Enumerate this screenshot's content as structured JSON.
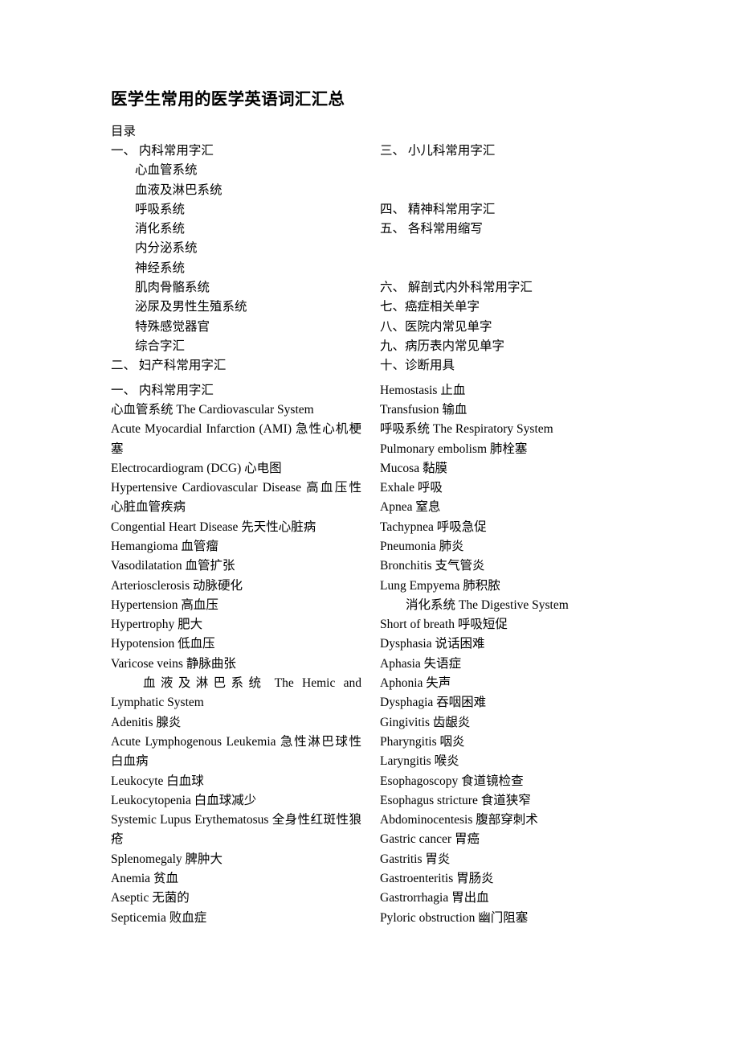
{
  "document": {
    "title": "医学生常用的医学英语词汇汇总",
    "toc_heading": "目录"
  },
  "toc": {
    "left": [
      {
        "text": "一、 内科常用字汇",
        "style": "num"
      },
      {
        "text": "心血管系统",
        "style": "indent"
      },
      {
        "text": "血液及淋巴系统",
        "style": "indent"
      },
      {
        "text": "呼吸系统",
        "style": "indent"
      },
      {
        "text": "消化系统",
        "style": "indent"
      },
      {
        "text": "内分泌系统",
        "style": "indent"
      },
      {
        "text": "神经系统",
        "style": "indent"
      },
      {
        "text": "肌肉骨骼系统",
        "style": "indent"
      },
      {
        "text": "泌尿及男性生殖系统",
        "style": "indent"
      },
      {
        "text": "特殊感觉器官",
        "style": "indent"
      },
      {
        "text": "综合字汇",
        "style": "indent"
      },
      {
        "text": "二、 妇产科常用字汇",
        "style": "num"
      }
    ],
    "right": [
      {
        "text": "三、 小儿科常用字汇",
        "style": "num"
      },
      {
        "text": "",
        "style": "blank"
      },
      {
        "text": "",
        "style": "blank"
      },
      {
        "text": "四、 精神科常用字汇",
        "style": "num"
      },
      {
        "text": "五、 各科常用缩写",
        "style": "num"
      },
      {
        "text": "",
        "style": "blank"
      },
      {
        "text": "",
        "style": "blank"
      },
      {
        "text": "六、 解剖式内外科常用字汇",
        "style": "num"
      },
      {
        "text": "七、癌症相关单字",
        "style": "num"
      },
      {
        "text": "八、医院内常见单字",
        "style": "num"
      },
      {
        "text": "九、病历表内常见单字",
        "style": "num"
      },
      {
        "text": "十、诊断用具",
        "style": "num"
      }
    ]
  },
  "body": {
    "left": [
      {
        "text": "一、 内科常用字汇",
        "style": "plain"
      },
      {
        "text": "心血管系统  The Cardiovascular System",
        "style": "plain"
      },
      {
        "text": "Acute Myocardial Infarction (AMI)  急性心机梗塞",
        "style": "justify-head"
      },
      {
        "text": "Electrocardiogram (DCG)  心电图",
        "style": "plain"
      },
      {
        "text": "Hypertensive Cardiovascular Disease  高血压性心脏血管疾病",
        "style": "justify-head"
      },
      {
        "text": "Congential Heart Disease  先天性心脏病",
        "style": "plain"
      },
      {
        "text": "Hemangioma  血管瘤",
        "style": "plain"
      },
      {
        "text": "Vasodilatation  血管扩张",
        "style": "plain"
      },
      {
        "text": "Arteriosclerosis  动脉硬化",
        "style": "plain"
      },
      {
        "text": "Hypertension  高血压",
        "style": "plain"
      },
      {
        "text": "Hypertrophy  肥大",
        "style": "plain"
      },
      {
        "text": "Hypotension  低血压",
        "style": "plain"
      },
      {
        "text": "Varicose veins  静脉曲张",
        "style": "plain"
      },
      {
        "text": "血液及淋巴系统  The Hemic and Lymphatic System",
        "style": "indent-j"
      },
      {
        "text": "Adenitis  腺炎",
        "style": "plain"
      },
      {
        "text": "Acute Lymphogenous Leukemia  急性淋巴球性白血病",
        "style": "justify-head"
      },
      {
        "text": "Leukocyte  白血球",
        "style": "plain"
      },
      {
        "text": "Leukocytopenia 白血球减少",
        "style": "plain"
      },
      {
        "text": "Systemic Lupus Erythematosus  全身性红斑性狼疮",
        "style": "justify-head"
      },
      {
        "text": "Splenomegaly  脾肿大",
        "style": "plain"
      },
      {
        "text": "Anemia 贫血",
        "style": "plain"
      },
      {
        "text": "Aseptic  无菌的",
        "style": "plain"
      },
      {
        "text": "Septicemia 败血症",
        "style": "plain"
      }
    ],
    "right": [
      {
        "text": "Hemostasis  止血",
        "style": "plain"
      },
      {
        "text": "Transfusion 输血",
        "style": "plain"
      },
      {
        "text": "呼吸系统  The Respiratory System",
        "style": "plain"
      },
      {
        "text": "Pulmonary embolism  肺栓塞",
        "style": "plain"
      },
      {
        "text": "Mucosa  黏膜",
        "style": "plain"
      },
      {
        "text": "Exhale 呼吸",
        "style": "plain"
      },
      {
        "text": "Apnea 窒息",
        "style": "plain"
      },
      {
        "text": "Tachypnea 呼吸急促",
        "style": "plain"
      },
      {
        "text": "Pneumonia 肺炎",
        "style": "plain"
      },
      {
        "text": "Bronchitis 支气管炎",
        "style": "plain"
      },
      {
        "text": "Lung Empyema  肺积脓",
        "style": "plain"
      },
      {
        "text": "消化系统  The Digestive System",
        "style": "indent"
      },
      {
        "text": "Short of breath  呼吸短促",
        "style": "plain"
      },
      {
        "text": "Dysphasia 说话困难",
        "style": "plain"
      },
      {
        "text": "Aphasia  失语症",
        "style": "plain"
      },
      {
        "text": "Aphonia 失声",
        "style": "plain"
      },
      {
        "text": "Dysphagia  吞咽困难",
        "style": "plain"
      },
      {
        "text": "Gingivitis  齿龈炎",
        "style": "plain"
      },
      {
        "text": "Pharyngitis  咽炎",
        "style": "plain"
      },
      {
        "text": "Laryngitis  喉炎",
        "style": "plain"
      },
      {
        "text": "Esophagoscopy  食道镜检查",
        "style": "plain"
      },
      {
        "text": "Esophagus stricture  食道狭窄",
        "style": "plain"
      },
      {
        "text": "Abdominocentesis 腹部穿刺术",
        "style": "plain"
      },
      {
        "text": "Gastric cancer  胃癌",
        "style": "plain"
      },
      {
        "text": "Gastritis  胃炎",
        "style": "plain"
      },
      {
        "text": "Gastroenteritis 胃肠炎",
        "style": "plain"
      },
      {
        "text": "Gastrorrhagia 胃出血",
        "style": "plain"
      },
      {
        "text": "Pyloric obstruction  幽门阻塞",
        "style": "plain"
      }
    ]
  }
}
